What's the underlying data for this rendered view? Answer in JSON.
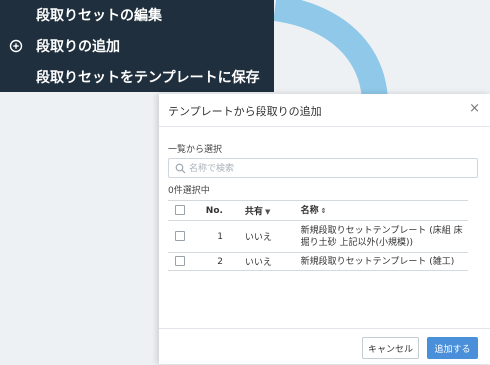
{
  "context_menu": {
    "items": [
      {
        "label": "段取りセットの編集",
        "icon": ""
      },
      {
        "label": "段取りの追加",
        "icon": "plus-circle-icon"
      },
      {
        "label": "段取りセットをテンプレートに保存",
        "icon": ""
      }
    ]
  },
  "decoration": {
    "arrow_color": "#8fc8e8"
  },
  "modal": {
    "title": "テンプレートから段取りの追加",
    "close_label": "×",
    "section_label": "一覧から選択",
    "search": {
      "placeholder": "名称で検索",
      "value": ""
    },
    "selected_count": "0件選択中",
    "table": {
      "headers": {
        "no": "No.",
        "shared": "共有",
        "name": "名称"
      },
      "rows": [
        {
          "no": "1",
          "shared": "いいえ",
          "name": "新規段取りセットテンプレート (床組 床掘り土砂 上記以外(小規模))"
        },
        {
          "no": "2",
          "shared": "いいえ",
          "name": "新規段取りセットテンプレート (雑工)"
        }
      ]
    },
    "footer": {
      "cancel_label": "キャンセル",
      "add_label": "追加する"
    }
  },
  "colors": {
    "menu_bg": "#1f2f3d",
    "primary": "#4a8fd9"
  }
}
